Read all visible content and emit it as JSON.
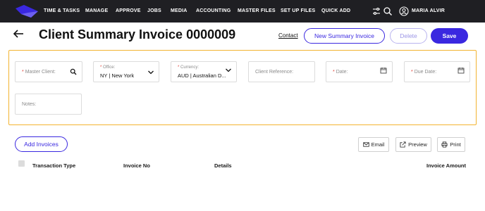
{
  "nav": {
    "items": [
      "TIME & TASKS",
      "MANAGE",
      "APPROVE",
      "JOBS",
      "MEDIA",
      "ACCOUNTING",
      "MASTER FILES",
      "SET UP FILES",
      "QUICK ADD"
    ],
    "user_name": "MARIA ALVIR",
    "icons": [
      "filter-sliders-icon",
      "search-icon",
      "user-circle-icon"
    ]
  },
  "header": {
    "title": "Client Summary Invoice 0000009",
    "contact_label": "Contact",
    "new_summary_label": "New Summary Invoice",
    "delete_label": "Delete",
    "save_label": "Save"
  },
  "form": {
    "master_client": {
      "required_mark": "*",
      "placeholder": "Master Client:"
    },
    "office": {
      "required_mark": "*",
      "label": "Office:",
      "value": "NY | New York"
    },
    "currency": {
      "required_mark": "*",
      "label": "Currency:",
      "value": "AUD | Australian D..."
    },
    "client_reference": {
      "placeholder": "Client Reference:"
    },
    "date": {
      "required_mark": "*",
      "placeholder": "Date:"
    },
    "due_date": {
      "required_mark": "*",
      "placeholder": "Due Date:"
    },
    "notes": {
      "placeholder": "Notes:"
    }
  },
  "actions": {
    "add_invoices_label": "Add Invoices",
    "email_label": "Email",
    "preview_label": "Preview",
    "print_label": "Print"
  },
  "table": {
    "columns": [
      "Transaction Type",
      "Invoice No",
      "Details",
      "Invoice Amount"
    ]
  },
  "colors": {
    "topbar": "#1f1f23",
    "accent": "#3a28e0",
    "highlight_border": "#f3b431",
    "required": "#e0443a"
  }
}
